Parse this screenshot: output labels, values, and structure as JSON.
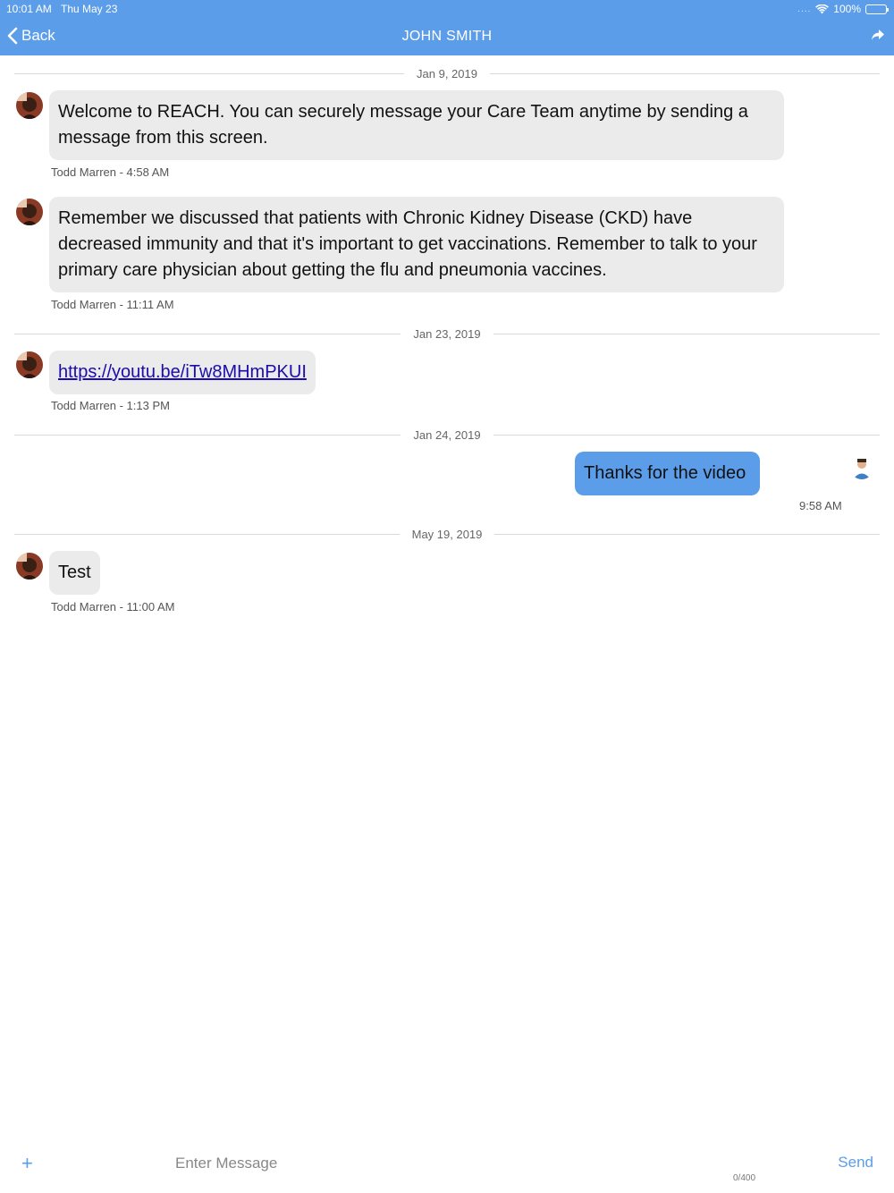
{
  "status_bar": {
    "time": "10:01 AM",
    "date": "Thu May 23",
    "signal": "....",
    "battery": "100%"
  },
  "nav": {
    "back_label": "Back",
    "title": "JOHN SMITH"
  },
  "conversation": [
    {
      "date": "Jan 9, 2019"
    },
    {
      "text": "Welcome to REACH. You can securely message your Care Team anytime by sending a message from this screen.",
      "meta": "Todd Marren - 4:58 AM"
    },
    {
      "text": "Remember we discussed that patients with Chronic Kidney Disease (CKD) have decreased immunity and that it's important to get vaccinations. Remember to talk to your primary care physician about getting the flu and pneumonia vaccines.",
      "meta": "Todd Marren - 11:11 AM"
    },
    {
      "date": "Jan 23, 2019"
    },
    {
      "link": "https://youtu.be/iTw8MHmPKUI",
      "meta": "Todd Marren - 1:13 PM"
    },
    {
      "date": "Jan 24, 2019"
    },
    {
      "text": "Thanks for the video",
      "meta": "9:58 AM"
    },
    {
      "date": "May 19, 2019"
    },
    {
      "text": "Test",
      "meta": "Todd Marren - 11:00 AM"
    }
  ],
  "composer": {
    "plus_label": "+",
    "placeholder": "Enter Message",
    "counter": "0/400",
    "send_label": "Send"
  },
  "colors": {
    "accent": "#5b9de8",
    "incoming_bubble": "#ebebeb",
    "link": "#1a0dab"
  },
  "icons": {
    "back": "chevron-left-icon",
    "share": "share-arrow-icon",
    "wifi": "wifi-icon",
    "battery": "battery-icon"
  }
}
